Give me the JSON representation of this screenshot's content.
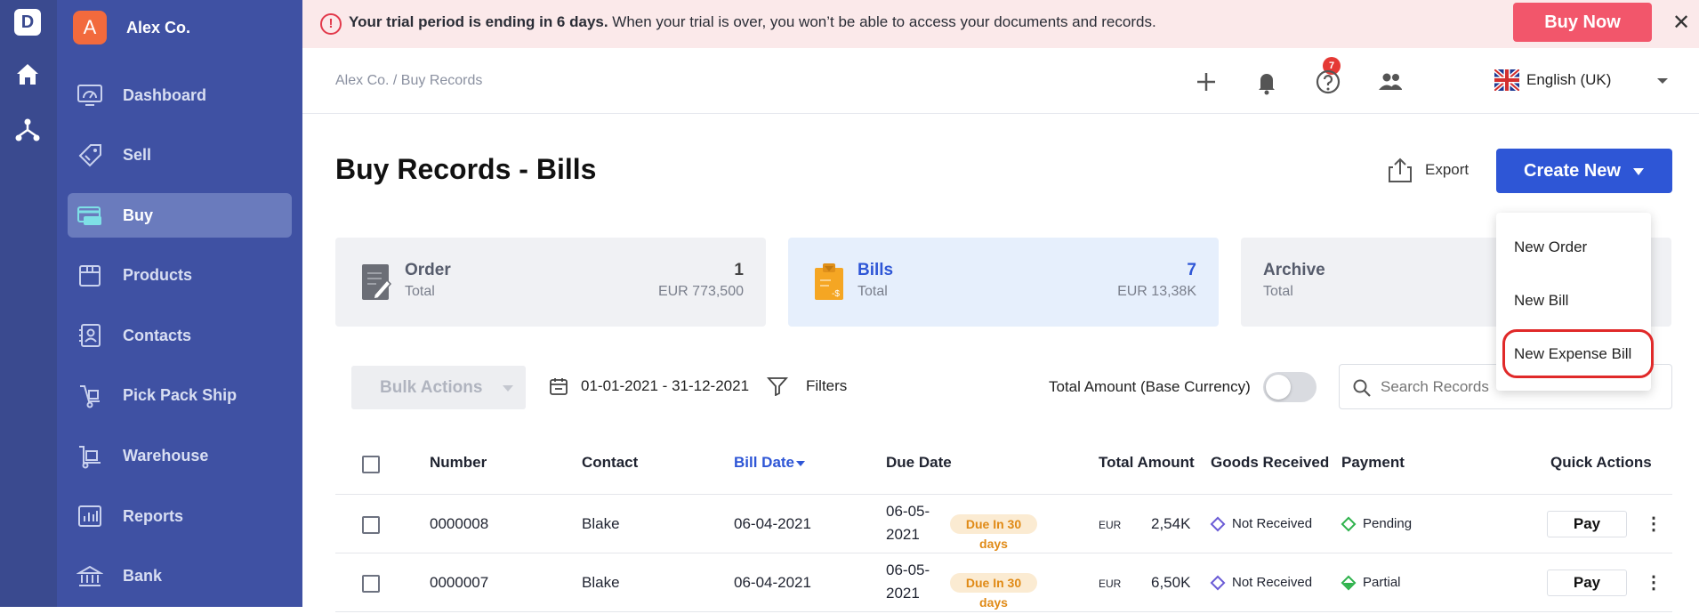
{
  "app": {
    "logo_letter": "D"
  },
  "rail": {
    "icons": [
      "home-icon",
      "hierarchy-icon"
    ]
  },
  "company": {
    "initial": "A",
    "name": "Alex Co."
  },
  "sidebar": {
    "items": [
      {
        "label": "Dashboard",
        "icon": "dashboard-icon",
        "active": false
      },
      {
        "label": "Sell",
        "icon": "sell-tag-icon",
        "active": false
      },
      {
        "label": "Buy",
        "icon": "buy-card-icon",
        "active": true
      },
      {
        "label": "Products",
        "icon": "products-box-icon",
        "active": false
      },
      {
        "label": "Contacts",
        "icon": "contacts-icon",
        "active": false
      },
      {
        "label": "Pick Pack Ship",
        "icon": "pick-pack-icon",
        "active": false
      },
      {
        "label": "Warehouse",
        "icon": "warehouse-icon",
        "active": false
      },
      {
        "label": "Reports",
        "icon": "reports-icon",
        "active": false
      },
      {
        "label": "Bank",
        "icon": "bank-icon",
        "active": false
      }
    ]
  },
  "banner": {
    "bold_text": "Your trial period is ending in 6 days.",
    "text": " When your trial is over, you won’t be able to access your documents and records.",
    "buy_now_label": "Buy Now",
    "close_symbol": "✕"
  },
  "header": {
    "breadcrumb": "Alex Co. / Buy Records",
    "notification_count": "7",
    "language": "English (UK)"
  },
  "page": {
    "title": "Buy Records - Bills",
    "export_label": "Export",
    "create_new_label": "Create New"
  },
  "cards": [
    {
      "title": "Order",
      "subtitle": "Total",
      "count": "1",
      "amount": "EUR 773,500",
      "active": false
    },
    {
      "title": "Bills",
      "subtitle": "Total",
      "count": "7",
      "amount": "EUR 13,38K",
      "active": true
    },
    {
      "title": "Archive",
      "subtitle": "Total",
      "count": "",
      "amount": "",
      "active": false
    }
  ],
  "toolbar": {
    "bulk_actions_label": "Bulk Actions",
    "date_range": "01-01-2021 - 31-12-2021",
    "filters_label": "Filters",
    "toggle_label": "Total Amount (Base Currency)",
    "toggle_on": false,
    "search_placeholder": "Search Records"
  },
  "table": {
    "columns": [
      "Number",
      "Contact",
      "Bill Date",
      "Due Date",
      "Total Amount",
      "Goods Received",
      "Payment",
      "Quick Actions"
    ],
    "sorted_column": "Bill Date",
    "rows": [
      {
        "number": "0000008",
        "contact": "Blake",
        "bill_date": "06-04-2021",
        "due_date_line1": "06-05-",
        "due_date_line2": "2021",
        "due_badge_line1": "Due In 30",
        "due_badge_line2": "days",
        "currency": "EUR",
        "amount": "2,54K",
        "goods": "Not Received",
        "payment": "Pending",
        "action": "Pay"
      },
      {
        "number": "0000007",
        "contact": "Blake",
        "bill_date": "06-04-2021",
        "due_date_line1": "06-05-",
        "due_date_line2": "2021",
        "due_badge_line1": "Due In 30",
        "due_badge_line2": "days",
        "currency": "EUR",
        "amount": "6,50K",
        "goods": "Not Received",
        "payment": "Partial",
        "action": "Pay"
      }
    ]
  },
  "dropdown": {
    "items": [
      "New Order",
      "New Bill",
      "New Expense Bill"
    ],
    "highlighted": "New Expense Bill"
  },
  "colors": {
    "sidebar": "#3f51a3",
    "rail": "#3a4a8f",
    "primary": "#2e56d6",
    "buy_now": "#f2566b",
    "banner": "#fbe9ea",
    "highlight_ring": "#e02929",
    "pending": "#2fb24c",
    "not_received": "#6a5bd6"
  }
}
